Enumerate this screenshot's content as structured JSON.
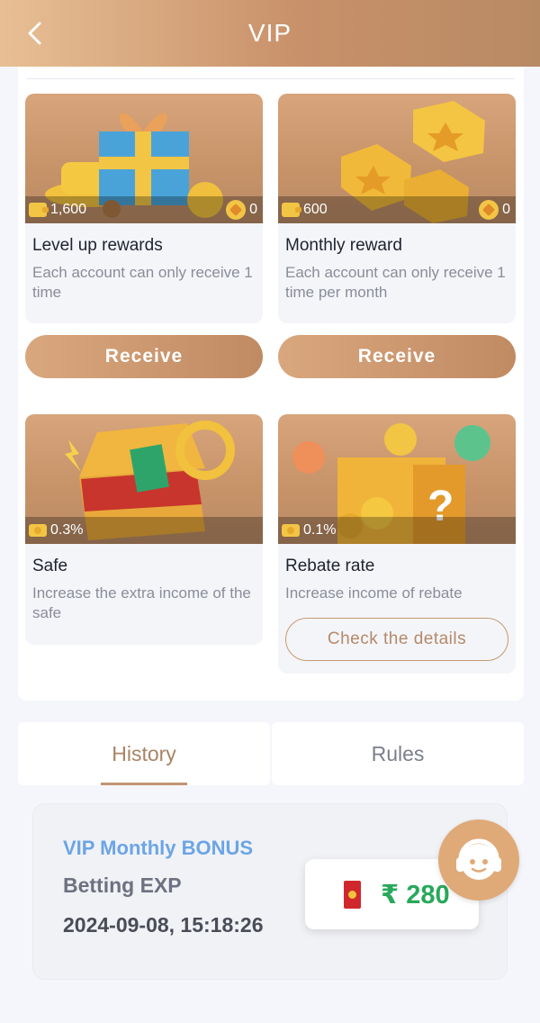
{
  "header": {
    "title": "VIP"
  },
  "benefits": [
    {
      "name": "Level up rewards",
      "desc": "Each account can only receive 1 time",
      "left_value": "1,600",
      "right_value": "0",
      "button": "Receive"
    },
    {
      "name": "Monthly reward",
      "desc": "Each account can only receive 1 time per month",
      "left_value": "600",
      "right_value": "0",
      "button": "Receive"
    },
    {
      "name": "Safe",
      "desc": "Increase the extra income of the safe",
      "left_value": "0.3%"
    },
    {
      "name": "Rebate rate",
      "desc": "Increase income of rebate",
      "left_value": "0.1%",
      "button": "Check the details"
    }
  ],
  "tabs": [
    {
      "label": "History",
      "active": true
    },
    {
      "label": "Rules",
      "active": false
    }
  ],
  "history": [
    {
      "title": "VIP Monthly BONUS",
      "type": "Betting EXP",
      "time": "2024-09-08, 15:18:26",
      "amount": "₹ 280"
    }
  ],
  "colors": {
    "brand": "#c8916a",
    "amount": "#28a85c",
    "history_title": "#6ba5e6"
  }
}
